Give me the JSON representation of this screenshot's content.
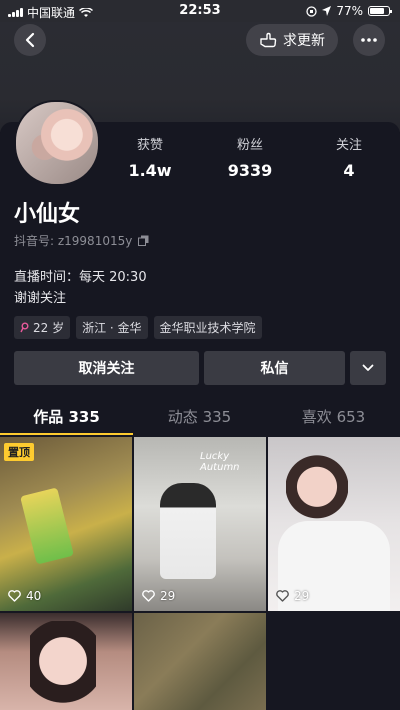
{
  "status_bar": {
    "carrier": "中国联通",
    "time": "22:53",
    "battery": "77%",
    "battery_level": 0.77
  },
  "header": {
    "request_update_label": "求更新"
  },
  "profile": {
    "stats": [
      {
        "label": "获赞",
        "value": "1.4w"
      },
      {
        "label": "粉丝",
        "value": "9339"
      },
      {
        "label": "关注",
        "value": "4"
      }
    ],
    "name": "小仙女",
    "douyin_id": "抖音号: z19981015y",
    "bio_lines": [
      "直播时间：每天 20:30",
      "谢谢关注"
    ],
    "tags": [
      "22 岁",
      "浙江 · 金华",
      "金华职业技术学院"
    ]
  },
  "actions": {
    "unfollow_label": "取消关注",
    "message_label": "私信"
  },
  "tabs": [
    {
      "label": "作品 335"
    },
    {
      "label": "动态 335"
    },
    {
      "label": "喜欢 653"
    }
  ],
  "videos": [
    {
      "likes": "40",
      "pinned_label": "置顶",
      "overlay_text": ""
    },
    {
      "likes": "29",
      "overlay_text": "Lucky Autumn"
    },
    {
      "likes": "29",
      "overlay_text": ""
    },
    {
      "likes": "",
      "overlay_text": ""
    },
    {
      "likes": "",
      "overlay_text": ""
    }
  ],
  "colors": {
    "accent": "#fecb2f",
    "background": "#161721",
    "button": "#3a3b43"
  }
}
